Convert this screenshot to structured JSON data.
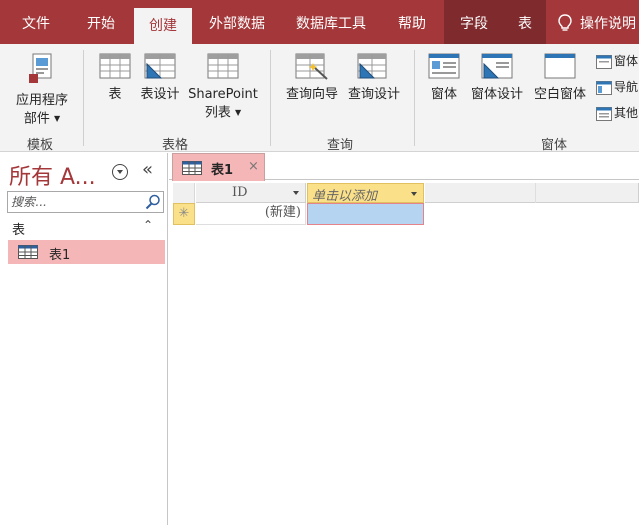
{
  "ribbon_tabs": [
    {
      "label": "文件"
    },
    {
      "label": "开始"
    },
    {
      "label": "创建"
    },
    {
      "label": "外部数据"
    },
    {
      "label": "数据库工具"
    },
    {
      "label": "帮助"
    },
    {
      "label": "字段"
    },
    {
      "label": "表"
    }
  ],
  "tell_me": {
    "label": "操作说明"
  },
  "ribbon": {
    "templates": {
      "app_parts_line1": "应用程序",
      "app_parts_line2": "部件",
      "group_label": "模板"
    },
    "tables": {
      "table": "表",
      "table_design": "表设计",
      "sharepoint_line1": "SharePoint",
      "sharepoint_line2": "列表",
      "group_label": "表格"
    },
    "queries": {
      "query_wizard": "查询向导",
      "query_design": "查询设计",
      "group_label": "查询"
    },
    "forms": {
      "form": "窗体",
      "form_design": "窗体设计",
      "blank_form": "空白窗体",
      "form_wizard": "窗体",
      "navigation": "导航",
      "more_forms": "其他",
      "group_label": "窗体"
    }
  },
  "nav_pane": {
    "title": "所有 A...",
    "shutter": "«",
    "search_placeholder": "搜索...",
    "group_name": "表",
    "group_toggle": "⌃",
    "items": [
      {
        "label": "表1"
      }
    ]
  },
  "document": {
    "tab_label": "表1",
    "close_glyph": "×",
    "columns": [
      {
        "header": "ID"
      },
      {
        "header": "单击以添加"
      }
    ],
    "new_row_marker": "✳",
    "new_row_value": "(新建)"
  },
  "colors": {
    "accent": "#a4373a",
    "context_tab": "#7f2a2d",
    "selected_item": "#f4b6b6",
    "add_column": "#fbe08a",
    "active_cell": "#b5d4f1"
  }
}
